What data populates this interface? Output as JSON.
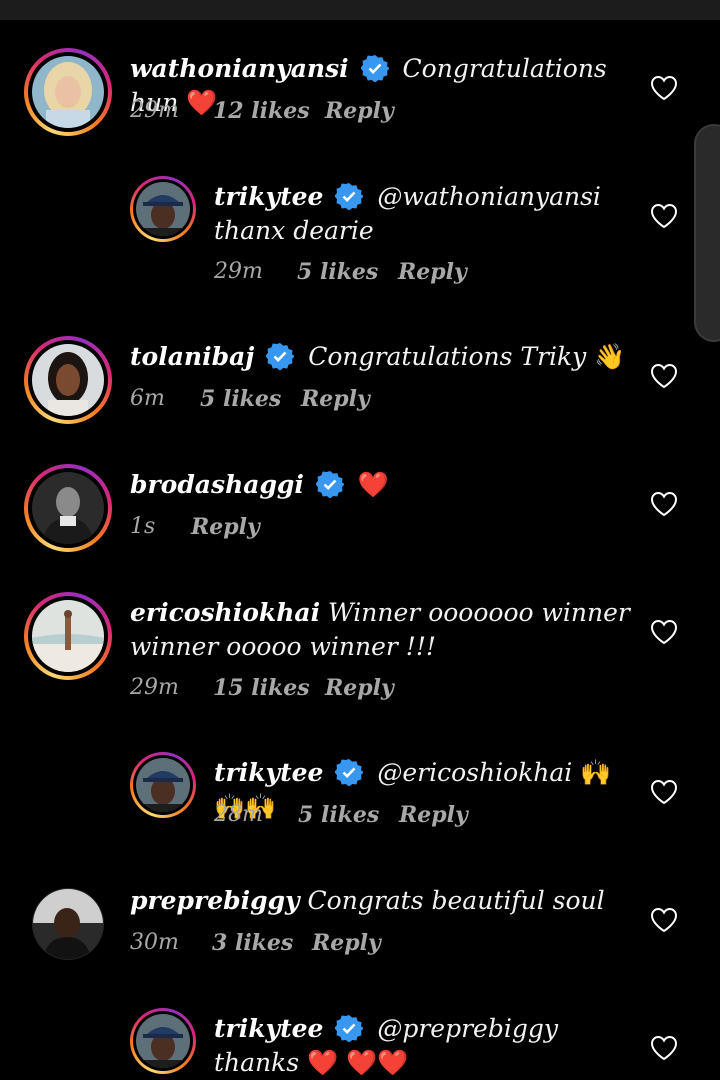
{
  "comments": [
    {
      "username": "wathonianyansi",
      "verified": true,
      "text": "Congratulations hun",
      "emoji": "❤️",
      "time": "29m",
      "likes": "12 likes",
      "reply": "Reply",
      "avatar_icon": "avatar-blonde-woman"
    },
    {
      "username": "trikytee",
      "verified": true,
      "text": "@wathonianyansi thanx dearie",
      "time": "29m",
      "likes": "5 likes",
      "reply": "Reply",
      "avatar_icon": "avatar-man-hat"
    },
    {
      "username": "tolanibaj",
      "verified": true,
      "text": "Congratulations Triky",
      "emoji": "👋",
      "time": "6m",
      "likes": "5 likes",
      "reply": "Reply",
      "avatar_icon": "avatar-woman"
    },
    {
      "username": "brodashaggi",
      "verified": true,
      "text": "",
      "emoji": "❤️",
      "time": "1s",
      "reply": "Reply",
      "avatar_icon": "avatar-man-bw"
    },
    {
      "username": "ericoshiokhai",
      "verified": false,
      "text": "Winner ooooooo winner winner ooooo winner !!!",
      "time": "29m",
      "likes": "15 likes",
      "reply": "Reply",
      "avatar_icon": "avatar-beach"
    },
    {
      "username": "trikytee",
      "verified": true,
      "text": "@ericoshiokhai",
      "emoji": "🙌🙌🙌",
      "time": "28m",
      "likes": "5 likes",
      "reply": "Reply",
      "avatar_icon": "avatar-man-hat"
    },
    {
      "username": "preprebiggy",
      "verified": false,
      "text": "Congrats beautiful soul",
      "time": "30m",
      "likes": "3 likes",
      "reply": "Reply",
      "avatar_icon": "avatar-selfie"
    },
    {
      "username": "trikytee",
      "verified": true,
      "text": "@preprebiggy thanks",
      "emoji": "❤️",
      "emoji_line2": "❤️❤️",
      "avatar_icon": "avatar-man-hat"
    }
  ],
  "colors": {
    "background": "#000000",
    "verified": "#3897f0",
    "meta": "#a8a8a8",
    "heart": "#ed1c3a"
  }
}
